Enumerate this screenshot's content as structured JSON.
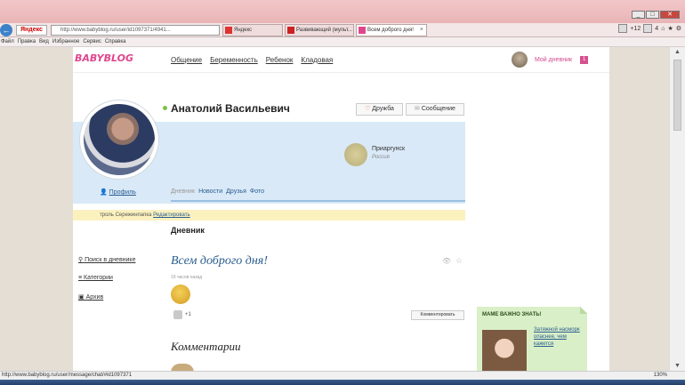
{
  "browser": {
    "yandex_label": "Яндекс",
    "address": "http://www.babyblog.ru/user/id1097371/4941...",
    "tabs": [
      "Яндекс",
      "Развивающий (мульт...",
      "Всем доброго дня!"
    ],
    "tab_count": "+12",
    "tab_count2": "4",
    "menu": [
      "Файл",
      "Правка",
      "Вид",
      "Избранное",
      "Сервис",
      "Справка"
    ],
    "status_url": "http://www.babyblog.ru/user/message/chat/#id1097371",
    "zoom": "130%"
  },
  "site": {
    "logo": "BABYBLOG",
    "nav": [
      "Общение",
      "Беременность",
      "Ребенок",
      "Кладовая"
    ],
    "my_diary": "Мой дневник",
    "diary_count": "1"
  },
  "profile": {
    "name": "Анатолий Васильевич",
    "friend_btn": "Дружба",
    "message_btn": "Сообщение",
    "city": "Приаргунск",
    "country": "Россия",
    "profile_link": "Профиль",
    "tabs": [
      "Дневник",
      "Новости",
      "Друзья",
      "Фото"
    ],
    "note": "троль Сережинпапка",
    "note_edit": "Редактировать"
  },
  "diary": {
    "title": "Дневник",
    "sidebar": [
      "Поиск в дневнике",
      "Категории",
      "Архив"
    ],
    "post_title": "Всем доброго дня!",
    "post_time": "19 часов назад",
    "likes": "+1",
    "comment_btn": "Комментировать",
    "comments_title": "Комментарии"
  },
  "promo": {
    "title": "МАМЕ ВАЖНО ЗНАТЬ!",
    "text": "Затяжной насморк опаснее, чем кажется"
  }
}
